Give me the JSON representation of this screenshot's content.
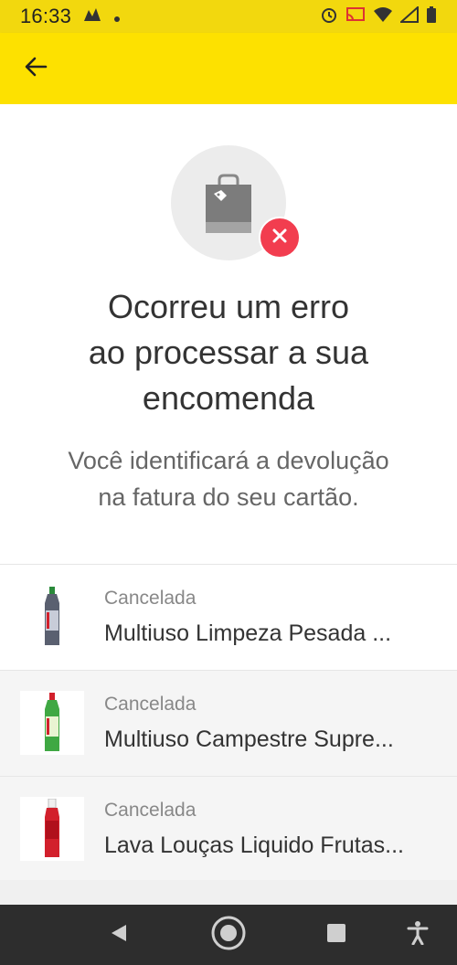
{
  "status_bar": {
    "time": "16:33"
  },
  "app_bar": {
    "back_icon": "arrow-left-icon"
  },
  "hero": {
    "icon": "shopping-bag-icon",
    "badge_icon": "close-icon",
    "badge_color": "#f23d4f",
    "title_lines": [
      "Ocorreu um erro",
      "ao processar a sua",
      "encomenda"
    ],
    "subtitle_lines": [
      "Você identificará a devolução",
      "na fatura do seu cartão."
    ]
  },
  "items": [
    {
      "status": "Cancelada",
      "name": "Multiuso Limpeza Pesada ...",
      "thumb_color": "#5a6070"
    },
    {
      "status": "Cancelada",
      "name": "Multiuso Campestre Supre...",
      "thumb_color": "#3fa843"
    },
    {
      "status": "Cancelada",
      "name": "Lava Louças Liquido Frutas...",
      "thumb_color": "#d2202c"
    }
  ],
  "colors": {
    "app_bar": "#fde100",
    "status_bar": "#f2d80e",
    "nav_bar": "#2d2d2d"
  }
}
